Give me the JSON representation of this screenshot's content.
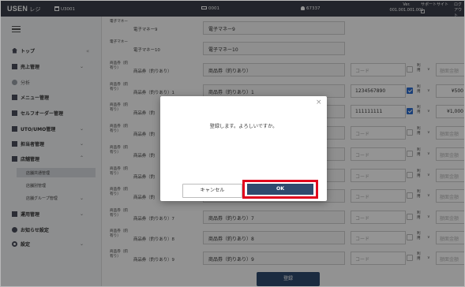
{
  "topbar": {
    "logo": "USEN",
    "logo_suffix": "レジ",
    "store_code": "U3001",
    "terminal_code": "0001",
    "user_code": "67337",
    "version_label": "Ver.",
    "version": "001.001.001.001",
    "support_label": "サポートサイト",
    "logout_label": "ログアウト"
  },
  "sidebar": {
    "collapse_symbol": "«",
    "items": [
      {
        "label": "トップ",
        "icon": "home-icon"
      },
      {
        "label": "売上管理",
        "icon": "sales-icon"
      },
      {
        "label": "分析",
        "icon": "analysis-icon"
      },
      {
        "label": "メニュー管理",
        "icon": "menu-icon"
      },
      {
        "label": "セルフオーダー管理",
        "icon": "self-order-icon"
      },
      {
        "label": "UTO/UMO管理",
        "icon": "uto-icon"
      },
      {
        "label": "担当者管理",
        "icon": "staff-icon"
      },
      {
        "label": "店舗管理",
        "icon": "store-icon"
      },
      {
        "label": "運用管理",
        "icon": "operation-icon"
      },
      {
        "label": "お知らせ設定",
        "icon": "notice-icon"
      },
      {
        "label": "設定",
        "icon": "gear-icon"
      }
    ],
    "store_sub": [
      "店舗共通管理",
      "店舗別管理",
      "店舗グループ管理"
    ]
  },
  "rows": [
    {
      "kind": "電子マネー",
      "name": "電子マネー9",
      "field": "電子マネー9",
      "code": "",
      "checked": false,
      "use": "",
      "amount": ""
    },
    {
      "kind": "電子マネー",
      "name": "電子マネー10",
      "field": "電子マネー10",
      "code": "",
      "checked": false,
      "use": "",
      "amount": ""
    },
    {
      "kind": "商品券（釣有り）",
      "name": "商品券（釣りあり）",
      "field": "商品券（釣りあり）",
      "code": "コード",
      "checked": false,
      "use": "利用",
      "amount": "額面金額"
    },
    {
      "kind": "商品券（釣有り）",
      "name": "商品券（釣りあり）1",
      "field": "商品券（釣りあり）1",
      "code": "1234567890",
      "checked": true,
      "use": "利用",
      "amount": "¥500"
    },
    {
      "kind": "商品券（釣有り）",
      "name": "商品券（釣",
      "field": "",
      "code": "111111111",
      "checked": true,
      "use": "利用",
      "amount": "¥1,000"
    },
    {
      "kind": "商品券（釣有り）",
      "name": "商品券（釣",
      "field": "",
      "code": "コード",
      "checked": false,
      "use": "利用",
      "amount": "額面金額"
    },
    {
      "kind": "商品券（釣有り）",
      "name": "商品券（釣",
      "field": "",
      "code": "コード",
      "checked": false,
      "use": "利用",
      "amount": "額面金額"
    },
    {
      "kind": "商品券（釣有り）",
      "name": "商品券（釣",
      "field": "",
      "code": "コード",
      "checked": false,
      "use": "利用",
      "amount": "額面金額"
    },
    {
      "kind": "商品券（釣有り）",
      "name": "商品券（釣",
      "field": "",
      "code": "コード",
      "checked": false,
      "use": "利用",
      "amount": "額面金額"
    },
    {
      "kind": "商品券（釣有り）",
      "name": "商品券（釣りあり）7",
      "field": "商品券（釣りあり）7",
      "code": "コード",
      "checked": false,
      "use": "利用",
      "amount": "額面金額"
    },
    {
      "kind": "商品券（釣有り）",
      "name": "商品券（釣りあり）8",
      "field": "商品券（釣りあり）8",
      "code": "コード",
      "checked": false,
      "use": "利用",
      "amount": "額面金額"
    },
    {
      "kind": "商品券（釣有り）",
      "name": "商品券（釣りあり）9",
      "field": "商品券（釣りあり）9",
      "code": "コード",
      "checked": false,
      "use": "利用",
      "amount": "額面金額"
    }
  ],
  "register_label": "登録",
  "dialog": {
    "message": "登録します。よろしいですか。",
    "cancel_label": "キャンセル",
    "ok_label": "OK",
    "close_symbol": "×",
    "highlight_color": "#e0001c"
  },
  "colors": {
    "topbar": "#3b3f4a",
    "primary_button": "#2f4a6e",
    "checkbox": "#2c6dd1"
  }
}
